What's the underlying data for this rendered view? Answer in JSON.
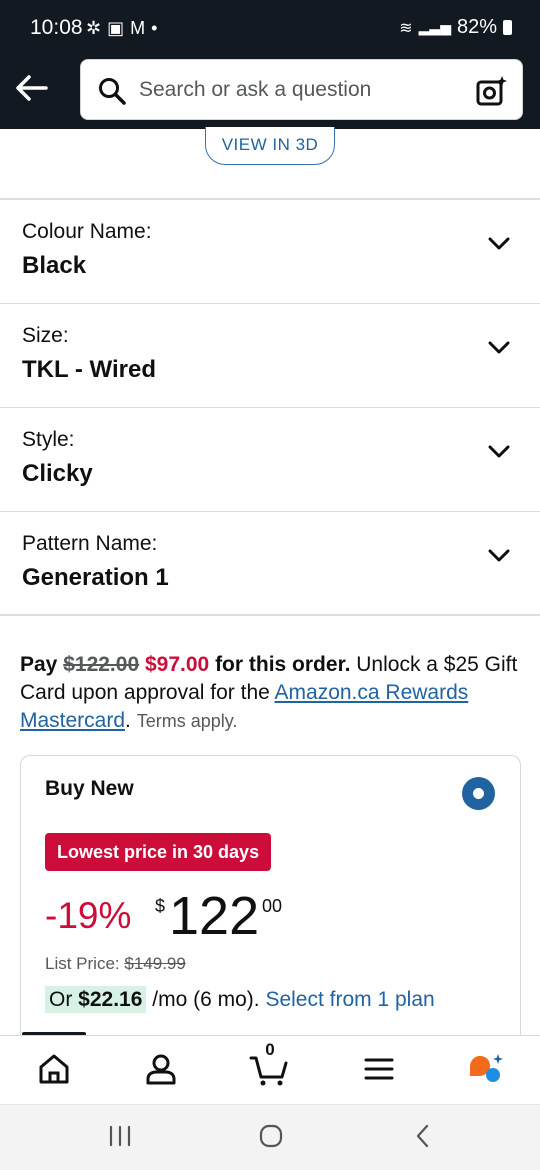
{
  "status_bar": {
    "time": "10:08",
    "battery": "82%"
  },
  "header": {
    "search_placeholder": "Search or ask a question"
  },
  "view_3d_label": "VIEW IN 3D",
  "variants": [
    {
      "label": "Colour Name:",
      "value": "Black"
    },
    {
      "label": "Size:",
      "value": "TKL - Wired"
    },
    {
      "label": "Style:",
      "value": "Clicky"
    },
    {
      "label": "Pattern Name:",
      "value": "Generation 1"
    }
  ],
  "promo": {
    "pay": "Pay",
    "old_price": "$122.00",
    "new_price": "$97.00",
    "for_order": "for this order.",
    "unlock": "Unlock a $25 Gift Card upon approval for the",
    "card_link": "Amazon.ca Rewards Mastercard",
    "period": ".",
    "terms": "Terms apply."
  },
  "buy_box": {
    "title": "Buy New",
    "badge": "Lowest price in 30 days",
    "discount": "-19%",
    "currency": "$",
    "price_whole": "122",
    "price_fraction": "00",
    "list_price_label": "List Price:",
    "list_price": "$149.99",
    "plan_or": "Or",
    "plan_amount": "$22.16",
    "plan_term": "/mo (6 mo).",
    "plan_link": "Select from 1 plan"
  },
  "bottom_nav": {
    "cart_count": "0"
  },
  "colors": {
    "header_bg": "#131921",
    "link": "#2162a1",
    "deal_red": "#cc0c39",
    "plan_highlight": "#d7f2e5"
  }
}
